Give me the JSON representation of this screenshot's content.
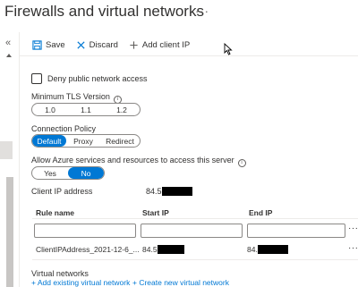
{
  "title": "Firewalls and virtual networks",
  "title_more": "···",
  "rail": {
    "collapse": "«"
  },
  "toolbar": {
    "save_label": "Save",
    "discard_label": "Discard",
    "add_client_ip_label": "Add client IP"
  },
  "public_access": {
    "label": "Deny public network access",
    "checked": false
  },
  "tls": {
    "label": "Minimum TLS Version",
    "options": [
      "1.0",
      "1.1",
      "1.2"
    ],
    "selected": null
  },
  "connection_policy": {
    "label": "Connection Policy",
    "options": [
      "Default",
      "Proxy",
      "Redirect"
    ],
    "selected": "Default"
  },
  "azure_services": {
    "label": "Allow Azure services and resources to access this server",
    "options": [
      "Yes",
      "No"
    ],
    "selected": "No"
  },
  "client_ip": {
    "label": "Client IP address",
    "value_prefix": "84.5"
  },
  "rules_table": {
    "columns": [
      "Rule name",
      "Start IP",
      "End IP"
    ],
    "rows": [
      {
        "rule_name": "ClientIPAddress_2021-12-6_...",
        "start_ip_prefix": "84.5",
        "end_ip_prefix": "84."
      }
    ],
    "row_more": "···"
  },
  "virtual_networks": {
    "label": "Virtual networks",
    "add_existing_link": "+ Add existing virtual network",
    "create_new_link": "+ Create new virtual network"
  },
  "colors": {
    "accent": "#0078d4",
    "text": "#323130",
    "border": "#8a8886"
  }
}
